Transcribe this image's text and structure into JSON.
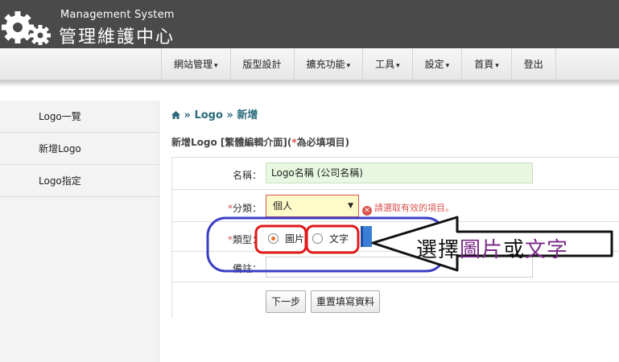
{
  "header": {
    "brand_en": "Management System",
    "brand_zh": "管理維護中心"
  },
  "nav": {
    "items": [
      {
        "label": "網站管理",
        "caret": "▾"
      },
      {
        "label": "版型設計",
        "caret": ""
      },
      {
        "label": "擴充功能",
        "caret": "▾"
      },
      {
        "label": "工具",
        "caret": "▾"
      },
      {
        "label": "設定",
        "caret": "▾"
      },
      {
        "label": "首頁",
        "caret": "▾"
      },
      {
        "label": "登出",
        "caret": ""
      }
    ]
  },
  "sidebar": {
    "items": [
      {
        "label": "Logo一覽"
      },
      {
        "label": "新增Logo"
      },
      {
        "label": "Logo指定"
      }
    ]
  },
  "breadcrumb": {
    "sep1": "»",
    "item1": "Logo",
    "sep2": "»",
    "item2": "新增"
  },
  "form_title": {
    "prefix": "新增Logo [繁體編輯介面](",
    "star": "*",
    "suffix": "為必填項目)"
  },
  "form": {
    "name_label": "名稱：",
    "name_value": "Logo名稱 (公司名稱)",
    "category_star": "*",
    "category_label": "分類：",
    "category_value": "個人",
    "category_arrow": "▼",
    "category_error": "請選取有效的項目。",
    "type_star": "*",
    "type_label": "類型：",
    "type_option_image": "圖片",
    "type_option_text": "文字",
    "notes_label": "備註：",
    "next_button": "下一步",
    "reset_button": "重置填寫資料"
  },
  "annotation": {
    "prefix": "選擇",
    "word1": "圖片",
    "middle": "或",
    "word2": "文字"
  },
  "colors": {
    "topbar": "#4a4a4a",
    "required": "#d9534f",
    "annotation_blue": "#3b3fc4",
    "annotation_red": "#e01818",
    "annotation_purple": "#7a2a86"
  }
}
